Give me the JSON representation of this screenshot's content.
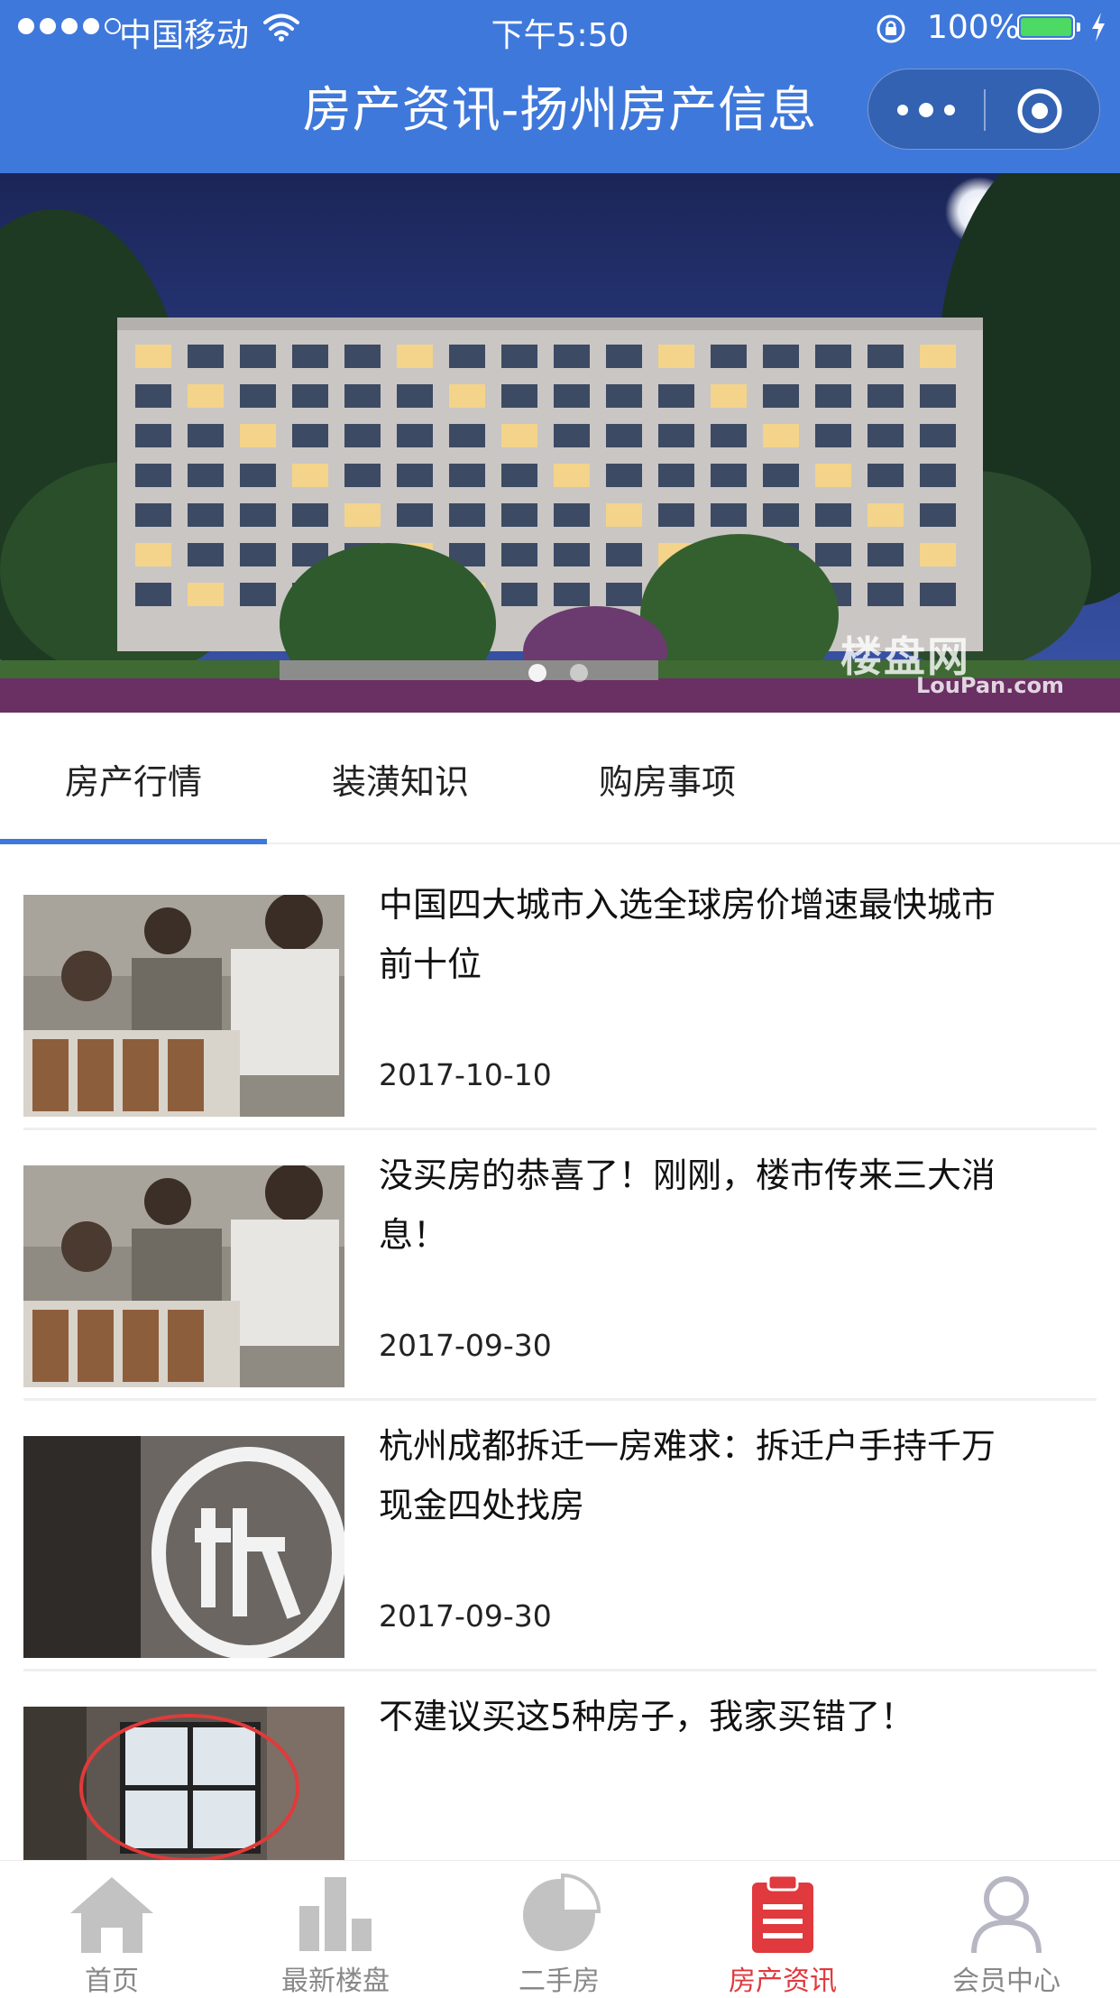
{
  "status_bar": {
    "carrier": "中国移动",
    "time": "下午5:50",
    "battery_percent": "100%",
    "battery_level": 1.0
  },
  "nav": {
    "title": "房产资讯-扬州房产信息"
  },
  "banner": {
    "watermark_cn": "楼盘网",
    "watermark_en": "LouPan.com",
    "slide_count": 2,
    "active_slide": 1
  },
  "tabs": [
    {
      "label": "房产行情",
      "active": true
    },
    {
      "label": "装潢知识",
      "active": false
    },
    {
      "label": "购房事项",
      "active": false
    }
  ],
  "news": [
    {
      "title": "中国四大城市入选全球房价增速最快城市前十位",
      "date": "2017-10-10"
    },
    {
      "title": "没买房的恭喜了！刚刚，楼市传来三大消息！",
      "date": "2017-09-30"
    },
    {
      "title": "杭州成都拆迁一房难求：拆迁户手持千万现金四处找房",
      "date": "2017-09-30"
    },
    {
      "title": "不建议买这5种房子，我家买错了！",
      "date": ""
    }
  ],
  "tabbar": [
    {
      "label": "首页",
      "icon": "home-icon",
      "active": false
    },
    {
      "label": "最新楼盘",
      "icon": "bar-chart-icon",
      "active": false
    },
    {
      "label": "二手房",
      "icon": "pie-chart-icon",
      "active": false
    },
    {
      "label": "房产资讯",
      "icon": "clipboard-icon",
      "active": true
    },
    {
      "label": "会员中心",
      "icon": "user-icon",
      "active": false
    }
  ],
  "colors": {
    "primary": "#3f78db",
    "active_tab": "#e0393e",
    "inactive_icon": "#c2c2c2"
  }
}
